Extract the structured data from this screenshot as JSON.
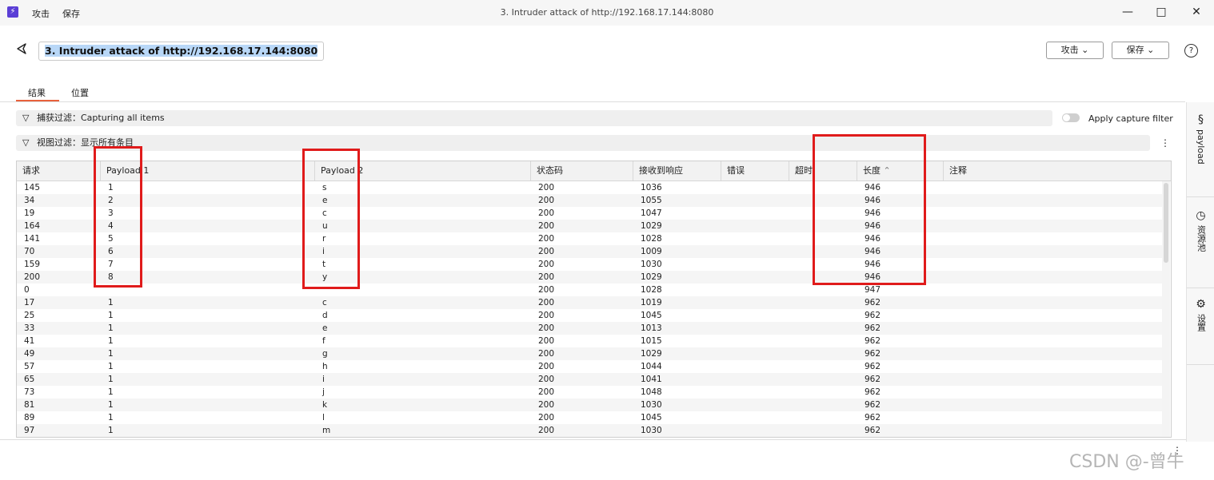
{
  "titlebar": {
    "menu": [
      "攻击",
      "保存"
    ],
    "window_title": "3. Intruder attack of http://192.168.17.144:8080"
  },
  "header": {
    "attack_title": "3. Intruder attack of http://192.168.17.144:8080",
    "attack_button": "攻击",
    "save_button": "保存"
  },
  "tabs": [
    {
      "label": "结果",
      "active": true
    },
    {
      "label": "位置",
      "active": false
    }
  ],
  "filters": {
    "capture_label": "捕获过滤",
    "capture_value": "Capturing all items",
    "apply_capture_filter": "Apply capture filter",
    "view_label": "视图过滤",
    "view_value": "显示所有条目"
  },
  "sidebar": {
    "items": [
      {
        "label": "payload",
        "icon": "section-icon"
      },
      {
        "label": "资源池",
        "icon": "clock-icon"
      },
      {
        "label": "设置",
        "icon": "gear-icon"
      }
    ]
  },
  "table": {
    "columns": [
      "请求",
      "Payload 1",
      "Payload 2",
      "状态码",
      "接收到响应",
      "错误",
      "超时",
      "长度",
      "注释"
    ],
    "sort_column": "长度",
    "sort_direction": "ascending",
    "rows": [
      [
        "145",
        "1",
        "s",
        "200",
        "1036",
        "",
        "",
        "946",
        ""
      ],
      [
        "34",
        "2",
        "e",
        "200",
        "1055",
        "",
        "",
        "946",
        ""
      ],
      [
        "19",
        "3",
        "c",
        "200",
        "1047",
        "",
        "",
        "946",
        ""
      ],
      [
        "164",
        "4",
        "u",
        "200",
        "1029",
        "",
        "",
        "946",
        ""
      ],
      [
        "141",
        "5",
        "r",
        "200",
        "1028",
        "",
        "",
        "946",
        ""
      ],
      [
        "70",
        "6",
        "i",
        "200",
        "1009",
        "",
        "",
        "946",
        ""
      ],
      [
        "159",
        "7",
        "t",
        "200",
        "1030",
        "",
        "",
        "946",
        ""
      ],
      [
        "200",
        "8",
        "y",
        "200",
        "1029",
        "",
        "",
        "946",
        ""
      ],
      [
        "0",
        "",
        "",
        "200",
        "1028",
        "",
        "",
        "947",
        ""
      ],
      [
        "17",
        "1",
        "c",
        "200",
        "1019",
        "",
        "",
        "962",
        ""
      ],
      [
        "25",
        "1",
        "d",
        "200",
        "1045",
        "",
        "",
        "962",
        ""
      ],
      [
        "33",
        "1",
        "e",
        "200",
        "1013",
        "",
        "",
        "962",
        ""
      ],
      [
        "41",
        "1",
        "f",
        "200",
        "1015",
        "",
        "",
        "962",
        ""
      ],
      [
        "49",
        "1",
        "g",
        "200",
        "1029",
        "",
        "",
        "962",
        ""
      ],
      [
        "57",
        "1",
        "h",
        "200",
        "1044",
        "",
        "",
        "962",
        ""
      ],
      [
        "65",
        "1",
        "i",
        "200",
        "1041",
        "",
        "",
        "962",
        ""
      ],
      [
        "73",
        "1",
        "j",
        "200",
        "1048",
        "",
        "",
        "962",
        ""
      ],
      [
        "81",
        "1",
        "k",
        "200",
        "1030",
        "",
        "",
        "962",
        ""
      ],
      [
        "89",
        "1",
        "l",
        "200",
        "1045",
        "",
        "",
        "962",
        ""
      ],
      [
        "97",
        "1",
        "m",
        "200",
        "1030",
        "",
        "",
        "962",
        ""
      ]
    ]
  },
  "watermark": "CSDN @-曾牛",
  "colors": {
    "accent": "#e8613c",
    "highlight_box": "#e01b1b",
    "app_icon": "#5b3fd6",
    "selection": "#b8d7f7"
  }
}
